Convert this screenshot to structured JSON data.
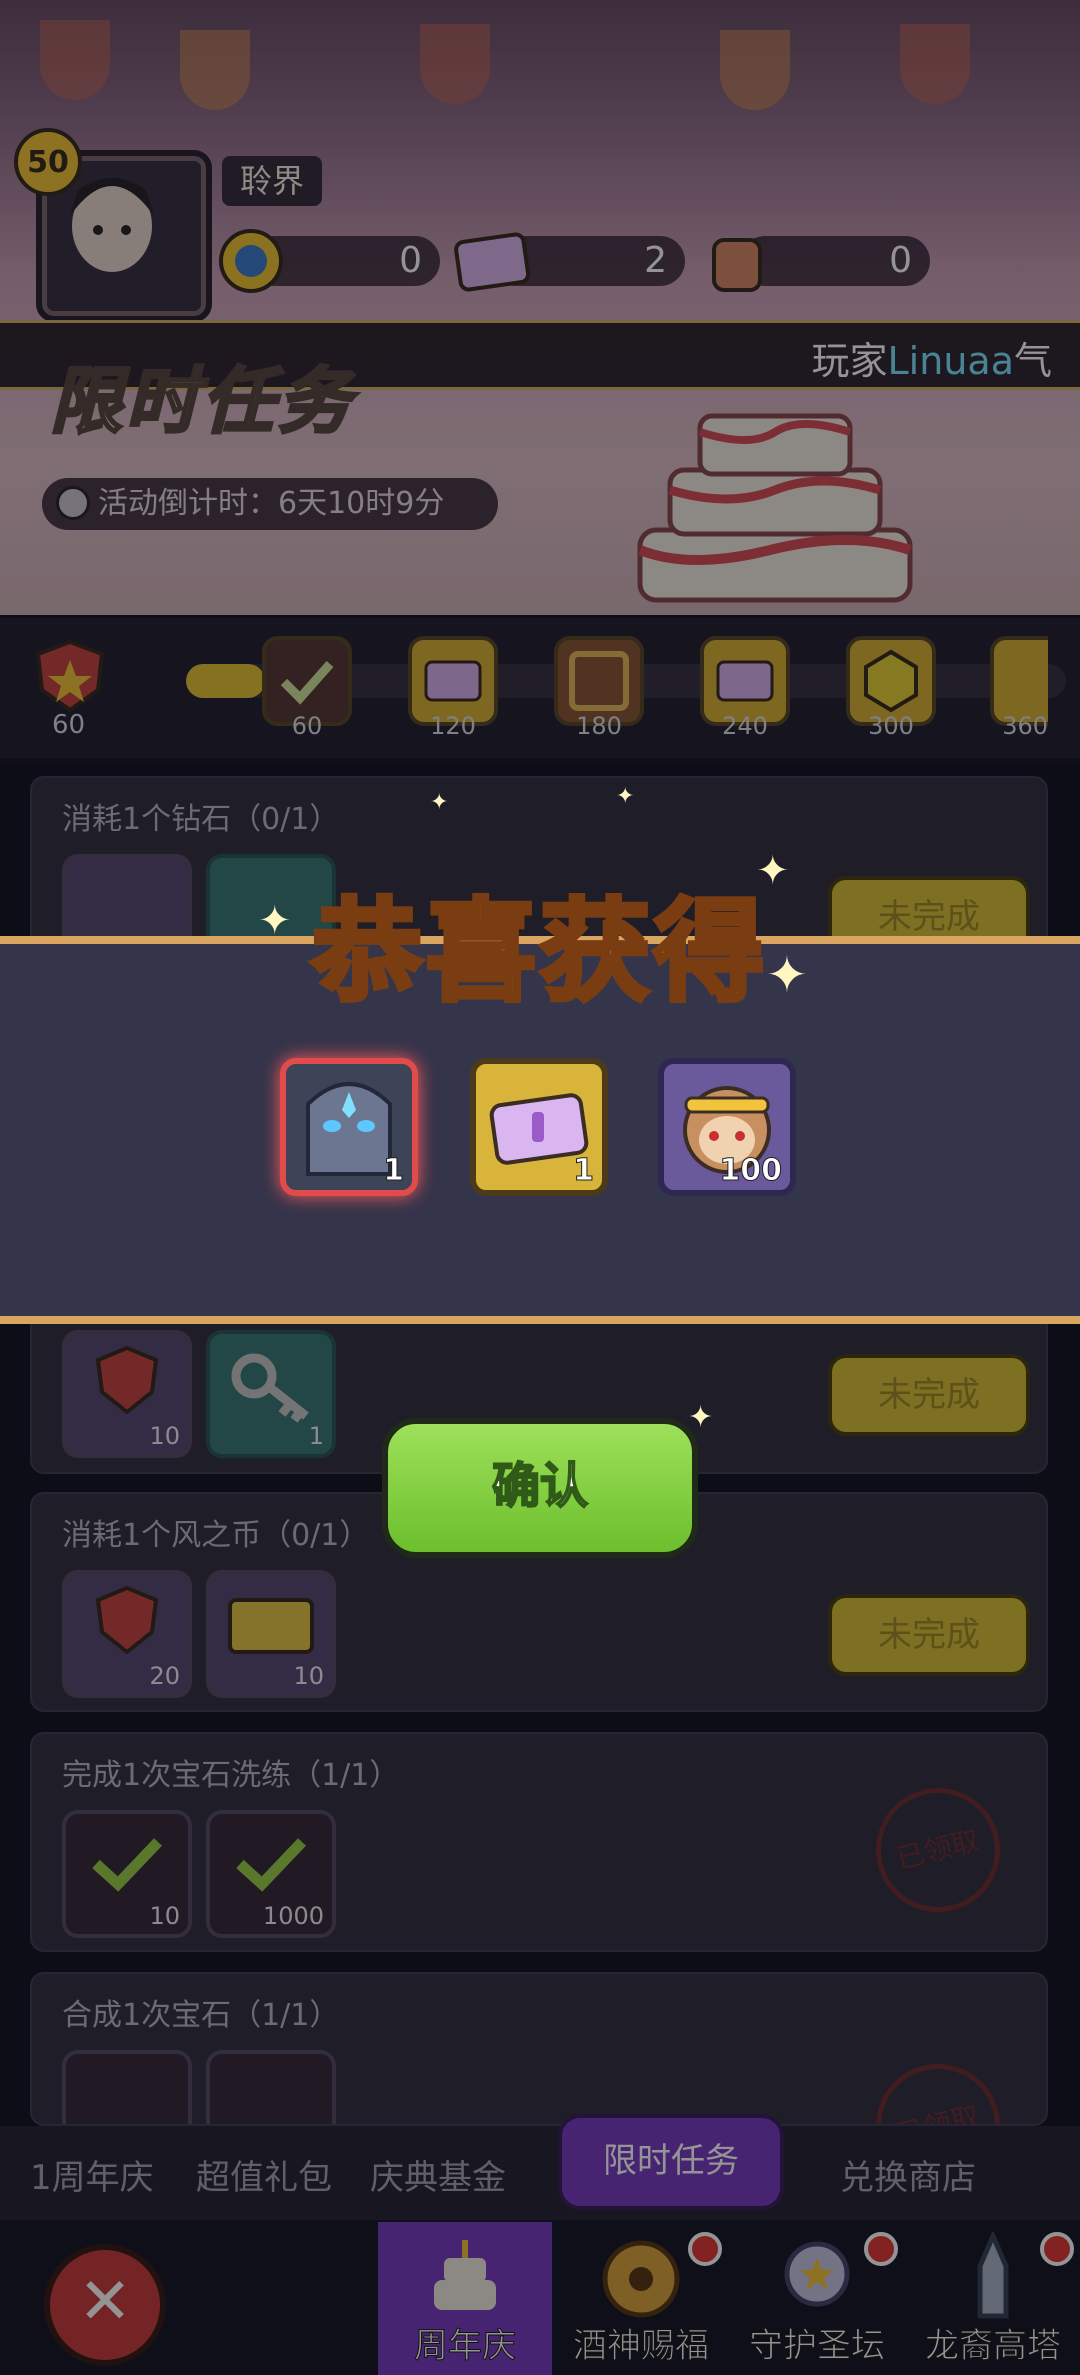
{
  "header": {
    "level": "50",
    "player_name": "聆界",
    "resources": [
      "0",
      "2",
      "0"
    ],
    "notice_prefix": "玩家",
    "notice_highlight": "Linuaa",
    "notice_suffix": "气"
  },
  "event": {
    "title": "限时任务",
    "countdown": "活动倒计时：6天10时9分"
  },
  "progress": {
    "medal_points": "60",
    "fill_fraction": 0.09,
    "milestones": [
      "60",
      "120",
      "180",
      "240",
      "300",
      "360"
    ]
  },
  "tasks": [
    {
      "title": "消耗1个钻石（0/1）",
      "rewards": [
        "",
        ""
      ],
      "status": "未完成"
    },
    {
      "title": "",
      "rewards": [
        "10",
        "1"
      ],
      "status": "未完成"
    },
    {
      "title": "消耗1个风之币（0/1）",
      "rewards": [
        "20",
        "10"
      ],
      "status": "未完成"
    },
    {
      "title": "完成1次宝石洗练（1/1）",
      "rewards": [
        "10",
        "1000"
      ],
      "status": "已领取"
    },
    {
      "title": "合成1次宝石（1/1）",
      "rewards": [
        "",
        ""
      ],
      "status": "已领取"
    }
  ],
  "popup": {
    "title": "恭喜获得",
    "items": [
      {
        "icon": "dark-knight-portrait-icon",
        "count": "1"
      },
      {
        "icon": "purple-ticket-icon",
        "count": "1"
      },
      {
        "icon": "monkey-king-portrait-icon",
        "count": "100"
      }
    ],
    "confirm_label": "确认"
  },
  "tabs": [
    {
      "label": "1周年庆"
    },
    {
      "label": "超值礼包"
    },
    {
      "label": "庆典基金"
    },
    {
      "label": "限时任务"
    },
    {
      "label": "兑换商店"
    }
  ],
  "bottom_nav": [
    {
      "label": "周年庆",
      "icon": "cake-icon"
    },
    {
      "label": "酒神赐福",
      "icon": "wheel-icon"
    },
    {
      "label": "守护圣坛",
      "icon": "altar-icon"
    },
    {
      "label": "龙裔高塔",
      "icon": "tower-icon"
    }
  ],
  "colors": {
    "accent_gold": "#d9a561",
    "confirm_green": "#6cbf2d",
    "active_tab": "#7b3fc5",
    "todo_button": "#d7c23d"
  }
}
